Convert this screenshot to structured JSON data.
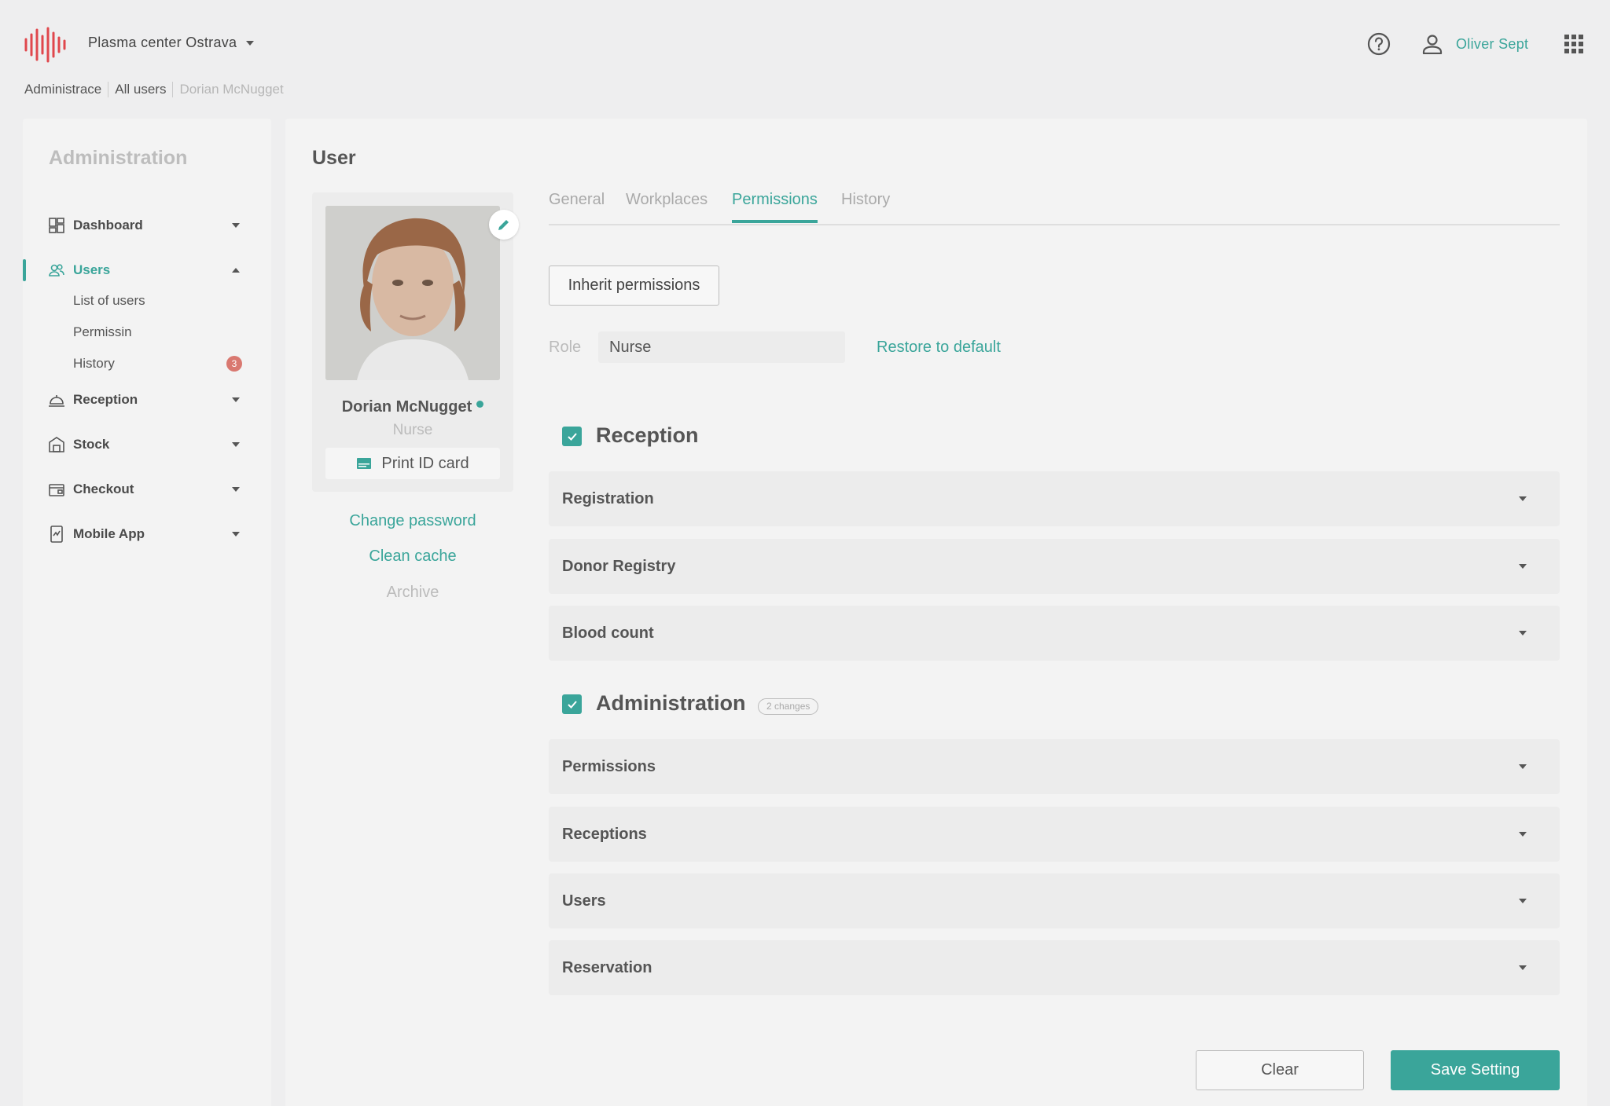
{
  "header": {
    "org_name": "Plasma center Ostrava",
    "user_name": "Oliver Sept"
  },
  "breadcrumb": [
    "Administrace",
    "All users",
    "Dorian McNugget"
  ],
  "sidebar": {
    "title": "Administration",
    "items": [
      {
        "label": "Dashboard"
      },
      {
        "label": "Users"
      },
      {
        "label": "Reception"
      },
      {
        "label": "Stock"
      },
      {
        "label": "Checkout"
      },
      {
        "label": "Mobile App"
      }
    ],
    "sub_items": [
      {
        "label": "List of users"
      },
      {
        "label": "Permissin"
      },
      {
        "label": "History",
        "badge": "3"
      }
    ]
  },
  "main": {
    "title": "User",
    "profile": {
      "name": "Dorian McNugget",
      "role": "Nurse",
      "print_label": "Print ID card"
    },
    "actions": {
      "change_password": "Change password",
      "clean_cache": "Clean cache",
      "archive": "Archive"
    },
    "tabs": [
      "General",
      "Workplaces",
      "Permissions",
      "History"
    ],
    "inherit_label": "Inherit permissions",
    "role_label": "Role",
    "role_value": "Nurse",
    "restore_label": "Restore to default",
    "sections": [
      {
        "title": "Reception",
        "items": [
          "Registration",
          "Donor Registry",
          "Blood count"
        ]
      },
      {
        "title": "Administration",
        "badge": "2 changes",
        "items": [
          "Permissions",
          "Receptions",
          "Users",
          "Reservation"
        ]
      }
    ],
    "clear_label": "Clear",
    "save_label": "Save Setting"
  },
  "colors": {
    "accent": "#3aa59a",
    "logo": "#e0474c",
    "badge": "#d97870"
  }
}
